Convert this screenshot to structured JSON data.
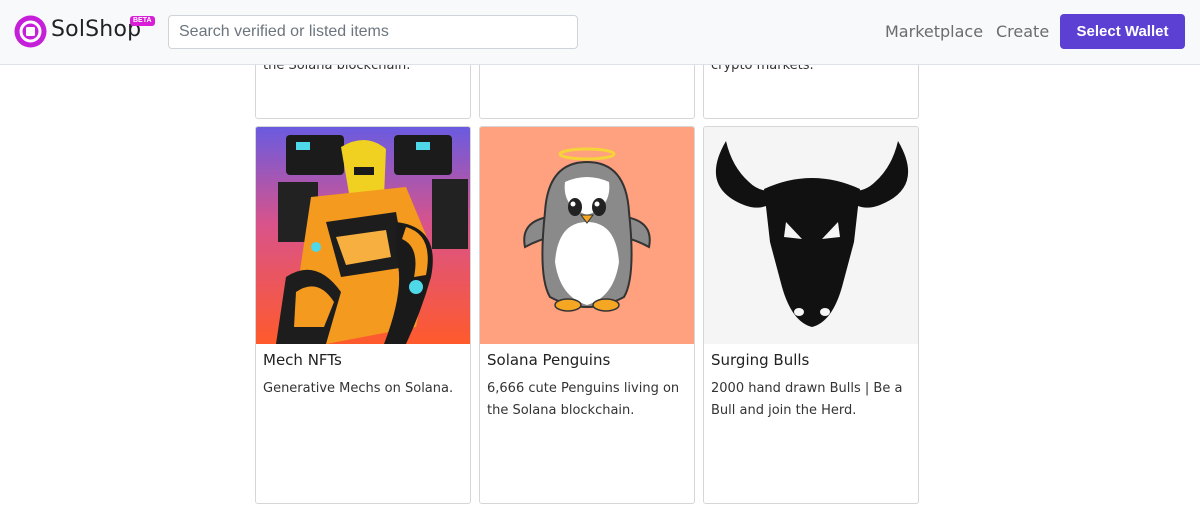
{
  "header": {
    "brand": "SolShop",
    "beta_badge": "BETA",
    "search_placeholder": "Search verified or listed items",
    "nav": {
      "marketplace": "Marketplace",
      "create": "Create"
    },
    "wallet_button": "Select Wallet"
  },
  "top_cards": [
    {
      "snippet": "the Solana blockchain."
    },
    {
      "snippet": ""
    },
    {
      "snippet": "crypto markets."
    }
  ],
  "cards": [
    {
      "title": "Mech NFTs",
      "description": "Generative Mechs on Solana.",
      "image_icon": "mech-robot-image"
    },
    {
      "title": "Solana Penguins",
      "description": "6,666 cute Penguins living on the Solana blockchain.",
      "image_icon": "penguin-image"
    },
    {
      "title": "Surging Bulls",
      "description": "2000 hand drawn Bulls | Be a Bull and join the Herd.",
      "image_icon": "bull-head-image"
    }
  ],
  "colors": {
    "accent": "#5c3fd3",
    "beta": "#d61fd6",
    "penguin_bg": "#ffa07f",
    "bull_bg": "#f5f5f5"
  }
}
